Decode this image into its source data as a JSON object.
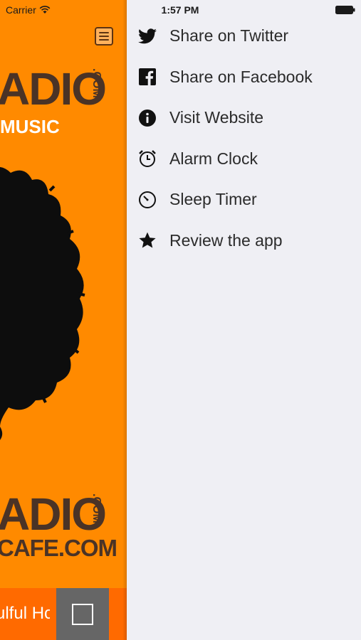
{
  "status_bar": {
    "carrier": "Carrier",
    "time": "1:57 PM"
  },
  "app": {
    "logo_top": "ADIO",
    "logo_top_com": ".COM",
    "tagline": "MUSIC",
    "logo_bottom": "ADIO",
    "logo_bottom_com": ".COM",
    "domain": "CAFE.COM",
    "now_playing": "ulful Ho",
    "colors": {
      "background": "#ff8a00",
      "player_bar": "#ff6a00",
      "stop_button": "#666666",
      "logo": "#4a3326"
    }
  },
  "menu": {
    "items": [
      {
        "label": "Share on Twitter",
        "icon": "twitter-icon"
      },
      {
        "label": "Share on Facebook",
        "icon": "facebook-icon"
      },
      {
        "label": "Visit Website",
        "icon": "info-icon"
      },
      {
        "label": "Alarm Clock",
        "icon": "alarm-clock-icon"
      },
      {
        "label": "Sleep Timer",
        "icon": "timer-icon"
      },
      {
        "label": "Review the app",
        "icon": "star-icon"
      }
    ],
    "colors": {
      "background": "#efeff4",
      "text": "#2b2b2b"
    }
  }
}
